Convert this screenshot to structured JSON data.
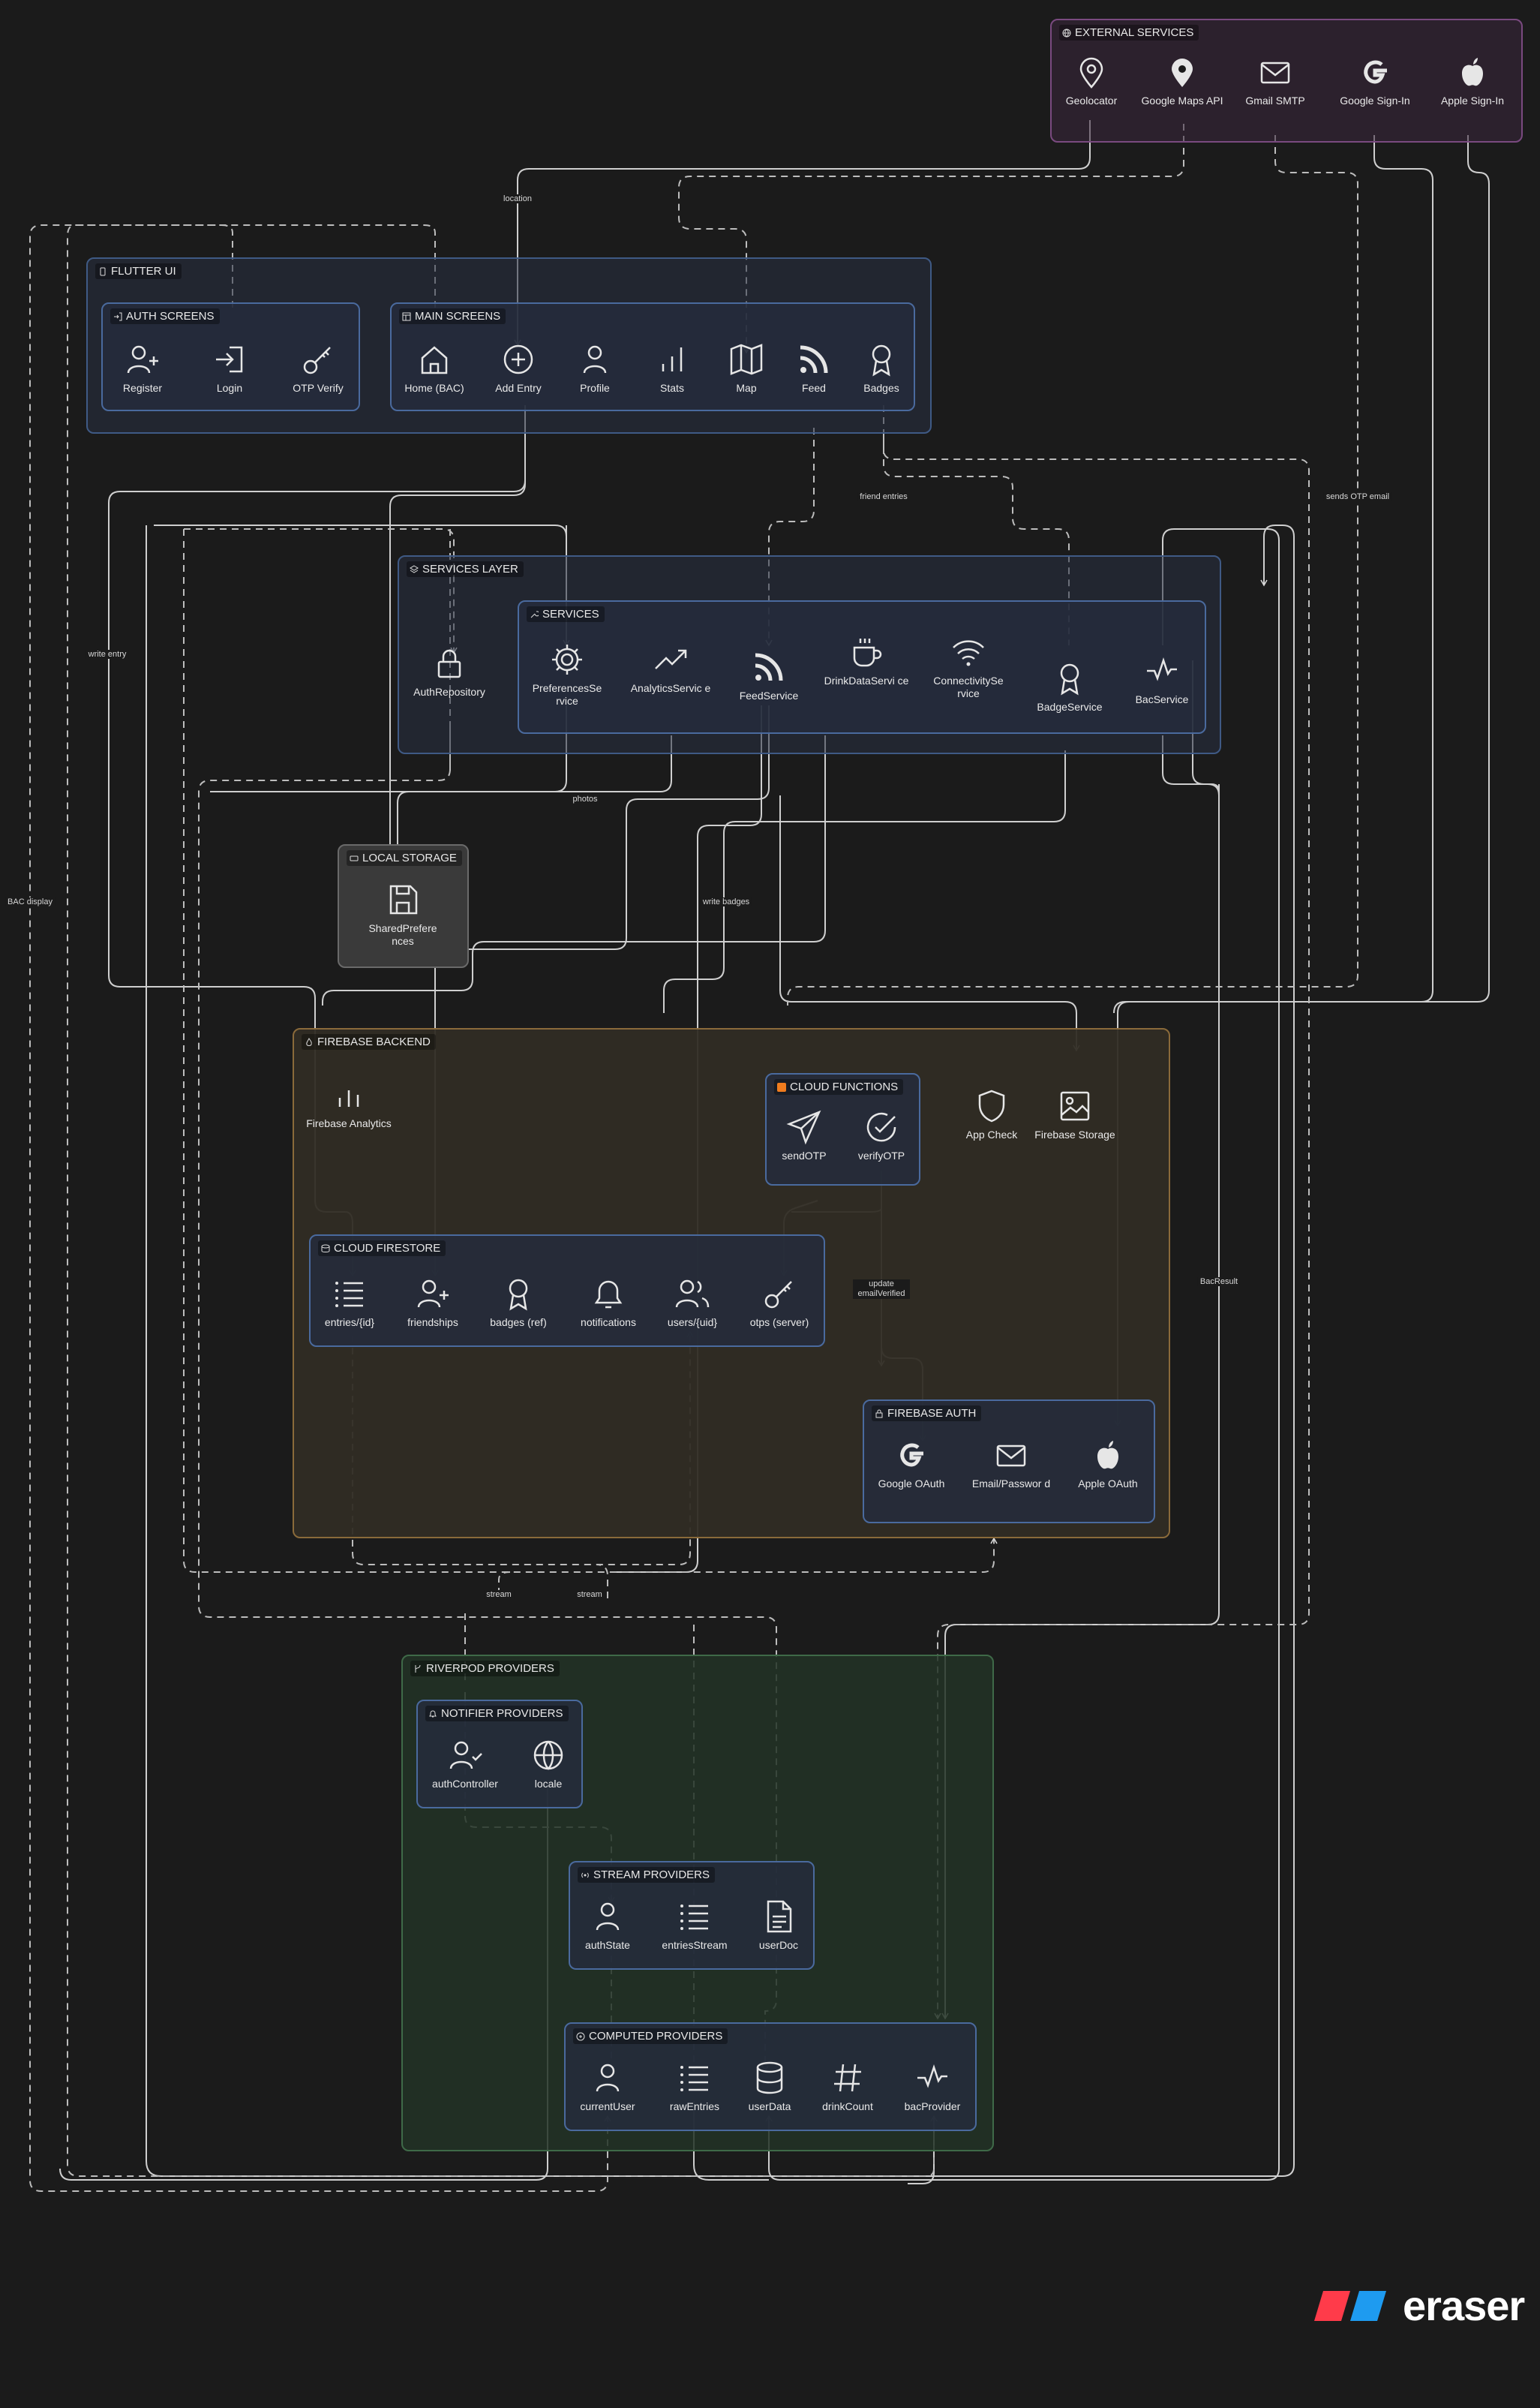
{
  "groups": {
    "external_services": "EXTERNAL SERVICES",
    "flutter_ui": "FLUTTER UI",
    "auth_screens": "AUTH SCREENS",
    "main_screens": "MAIN SCREENS",
    "services_layer": "SERVICES LAYER",
    "services": "SERVICES",
    "local_storage": "LOCAL STORAGE",
    "firebase_backend": "FIREBASE BACKEND",
    "cloud_functions": "CLOUD FUNCTIONS",
    "cloud_firestore": "CLOUD FIRESTORE",
    "firebase_auth": "FIREBASE AUTH",
    "riverpod_providers": "RIVERPOD PROVIDERS",
    "notifier_providers": "NOTIFIER PROVIDERS",
    "stream_providers": "STREAM PROVIDERS",
    "computed_providers": "COMPUTED PROVIDERS"
  },
  "nodes": {
    "geolocator": "Geolocator",
    "google_maps": "Google Maps API",
    "gmail_smtp": "Gmail SMTP",
    "google_signin": "Google Sign-In",
    "apple_signin": "Apple Sign-In",
    "register": "Register",
    "login": "Login",
    "otp_verify": "OTP Verify",
    "home": "Home (BAC)",
    "add_entry": "Add Entry",
    "profile": "Profile",
    "stats": "Stats",
    "map": "Map",
    "feed": "Feed",
    "badges": "Badges",
    "auth_repository": "AuthRepository",
    "preferences_service": "PreferencesSe rvice",
    "analytics_service": "AnalyticsServic e",
    "feed_service": "FeedService",
    "drink_data_service": "DrinkDataServi ce",
    "connectivity_service": "ConnectivitySe rvice",
    "badge_service": "BadgeService",
    "bac_service": "BacService",
    "shared_preferences": "SharedPrefere nces",
    "firebase_analytics": "Firebase Analytics",
    "send_otp": "sendOTP",
    "verify_otp": "verifyOTP",
    "app_check": "App Check",
    "firebase_storage": "Firebase Storage",
    "entries": "entries/{id}",
    "friendships": "friendships",
    "badges_ref": "badges (ref)",
    "notifications": "notifications",
    "users": "users/{uid}",
    "otps": "otps (server)",
    "google_oauth": "Google OAuth",
    "email_password": "Email/Passwor d",
    "apple_oauth": "Apple OAuth",
    "auth_controller": "authController",
    "locale": "locale",
    "auth_state": "authState",
    "entries_stream": "entriesStream",
    "user_doc": "userDoc",
    "current_user": "currentUser",
    "raw_entries": "rawEntries",
    "user_data": "userData",
    "drink_count": "drinkCount",
    "bac_provider": "bacProvider"
  },
  "edge_labels": {
    "location": "location",
    "write_entry": "write entry",
    "bac_display": "BAC display",
    "friend_entries": "friend entries",
    "sends_otp_email": "sends OTP email",
    "photos": "photos",
    "write_badges": "write badges",
    "update_email_verified": "update emailVerified",
    "bac_result": "BacResult",
    "stream_1": "stream",
    "stream_2": "stream"
  },
  "brand": {
    "name": "eraser",
    "colors": {
      "red": "#ff3b4a",
      "blue": "#1e9bf0"
    }
  }
}
